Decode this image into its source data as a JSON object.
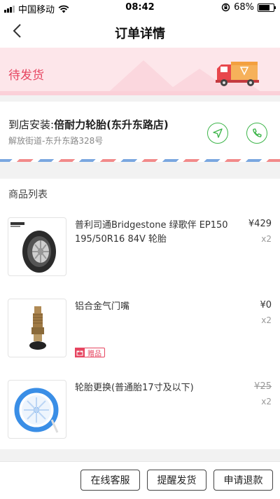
{
  "status_bar": {
    "carrier": "中国移动",
    "time": "08:42",
    "battery": "68%",
    "battery_level": 0.68,
    "icons": [
      "signal-icon",
      "wifi-icon",
      "orientation-lock-icon",
      "battery-icon"
    ]
  },
  "nav": {
    "title": "订单详情",
    "back_icon": "chevron-left-icon"
  },
  "order_status": {
    "label": "待发货",
    "icon": "delivery-truck-icon",
    "color": "#e64560"
  },
  "store": {
    "prefix": "到店安装:",
    "name": "倍耐力轮胎(东升东路店)",
    "address": "解放街道-东升东路328号",
    "navigate_icon": "navigation-icon",
    "call_icon": "phone-icon",
    "accent": "#3db54a"
  },
  "products": {
    "heading": "商品列表",
    "items": [
      {
        "name": "普利司通Bridgestone 绿歌伴 EP150 195/50R16 84V 轮胎",
        "price": "¥429",
        "qty": "x2",
        "thumbnail": "tire-image",
        "strikethrough": false
      },
      {
        "name": "铝合金气门嘴",
        "price": "¥0",
        "qty": "x2",
        "thumbnail": "valve-stem-image",
        "badge": "赠品",
        "badge_icon": "gift-icon",
        "strikethrough": false
      },
      {
        "name": "轮胎更换(普通胎17寸及以下)",
        "price": "¥25",
        "qty": "x2",
        "thumbnail": "wheel-service-image",
        "strikethrough": true
      }
    ]
  },
  "actions": {
    "customer_service": "在线客服",
    "remind_shipping": "提醒发货",
    "refund": "申请退款"
  }
}
